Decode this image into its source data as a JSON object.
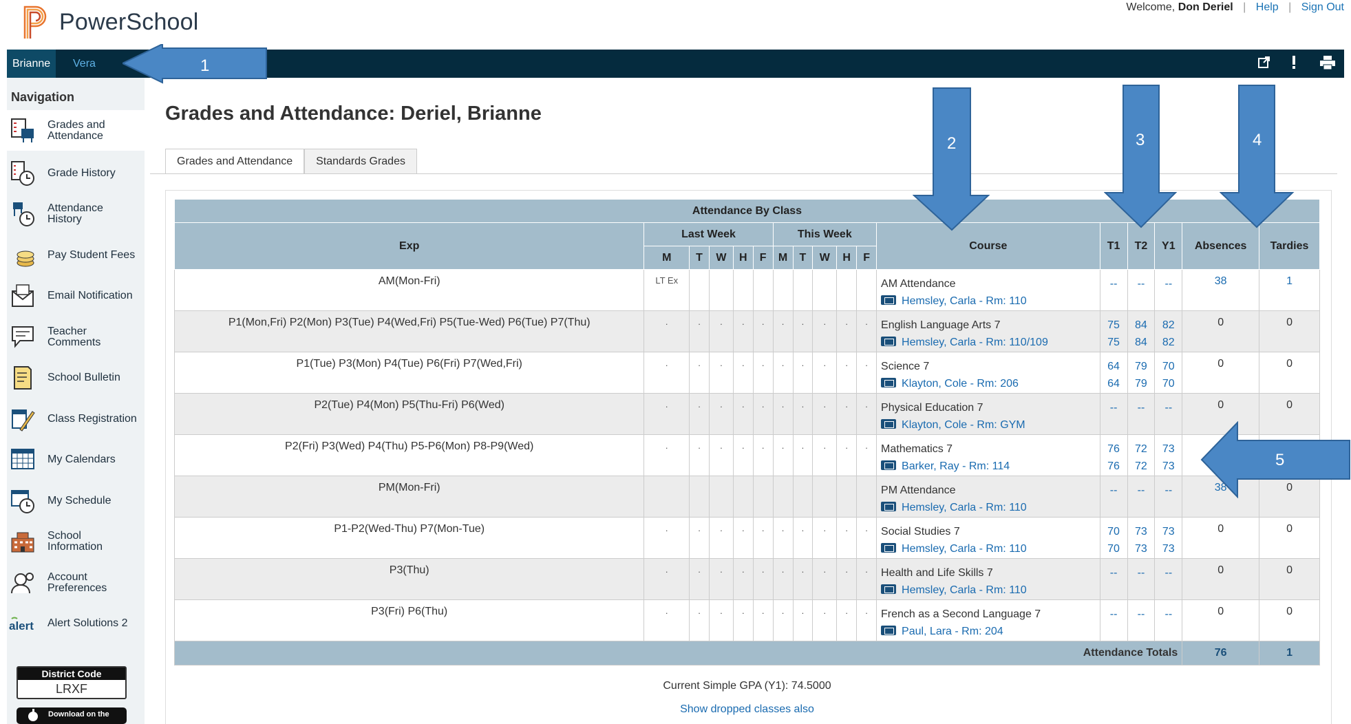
{
  "app": {
    "name": "PowerSchool"
  },
  "top_links": {
    "welcome_prefix": "Welcome,",
    "user_name": "Don Deriel",
    "help": "Help",
    "sign_out": "Sign Out"
  },
  "students": [
    "Brianne",
    "Vera"
  ],
  "toolbar_icons": [
    "external-link-icon",
    "alert-icon",
    "print-icon"
  ],
  "nav": {
    "title": "Navigation",
    "items": [
      {
        "label": "Grades and Attendance",
        "icon": "grades-attendance-icon"
      },
      {
        "label": "Grade History",
        "icon": "grade-history-icon"
      },
      {
        "label": "Attendance History",
        "icon": "attendance-history-icon"
      },
      {
        "label": "Pay Student Fees",
        "icon": "fees-icon"
      },
      {
        "label": "Email Notification",
        "icon": "email-icon"
      },
      {
        "label": "Teacher Comments",
        "icon": "comments-icon"
      },
      {
        "label": "School Bulletin",
        "icon": "bulletin-icon"
      },
      {
        "label": "Class Registration",
        "icon": "registration-icon"
      },
      {
        "label": "My Calendars",
        "icon": "calendar-icon"
      },
      {
        "label": "My Schedule",
        "icon": "schedule-icon"
      },
      {
        "label": "School Information",
        "icon": "school-icon"
      },
      {
        "label": "Account Preferences",
        "icon": "account-icon"
      },
      {
        "label": "Alert Solutions 2",
        "icon": "alert-solutions-icon"
      }
    ],
    "district_code_label": "District Code",
    "district_code": "LRXF",
    "app_store": "Download on the"
  },
  "page": {
    "title": "Grades and Attendance: Deriel, Brianne",
    "tabs": [
      "Grades and Attendance",
      "Standards Grades"
    ]
  },
  "table": {
    "caption": "Attendance By Class",
    "col_exp": "Exp",
    "last_week": "Last Week",
    "this_week": "This Week",
    "days": [
      "M",
      "T",
      "W",
      "H",
      "F",
      "M",
      "T",
      "W",
      "H",
      "F"
    ],
    "col_course": "Course",
    "col_t1": "T1",
    "col_t2": "T2",
    "col_y1": "Y1",
    "col_absences": "Absences",
    "col_tardies": "Tardies",
    "rows": [
      {
        "exp": "AM(Mon-Fri)",
        "days": [
          "LT Ex",
          "",
          "",
          "",
          "",
          "",
          "",
          "",
          "",
          ""
        ],
        "course": "AM Attendance",
        "teacher": "Hemsley, Carla",
        "room": "- Rm: 110",
        "t1": [
          "--"
        ],
        "t2": [
          "--"
        ],
        "y1": [
          "--"
        ],
        "absences": "38",
        "absences_link": true,
        "tardies": "1",
        "tardies_link": true
      },
      {
        "exp": "P1(Mon,Fri) P2(Mon) P3(Tue) P4(Wed,Fri) P5(Tue-Wed) P6(Tue) P7(Thu)",
        "days": [
          ".",
          ".",
          ".",
          ".",
          ".",
          ".",
          ".",
          ".",
          ".",
          "."
        ],
        "course": "English Language Arts 7",
        "teacher": "Hemsley, Carla",
        "room": "- Rm: 110/109",
        "t1": [
          "75",
          "75"
        ],
        "t2": [
          "84",
          "84"
        ],
        "y1": [
          "82",
          "82"
        ],
        "absences": "0",
        "tardies": "0"
      },
      {
        "exp": "P1(Tue) P3(Mon) P4(Tue) P6(Fri) P7(Wed,Fri)",
        "days": [
          ".",
          ".",
          ".",
          ".",
          ".",
          ".",
          ".",
          ".",
          ".",
          "."
        ],
        "course": "Science 7",
        "teacher": "Klayton, Cole",
        "room": "- Rm: 206",
        "t1": [
          "64",
          "64"
        ],
        "t2": [
          "79",
          "79"
        ],
        "y1": [
          "70",
          "70"
        ],
        "absences": "0",
        "tardies": "0"
      },
      {
        "exp": "P2(Tue) P4(Mon) P5(Thu-Fri) P6(Wed)",
        "days": [
          ".",
          ".",
          ".",
          ".",
          ".",
          ".",
          ".",
          ".",
          ".",
          "."
        ],
        "course": "Physical Education 7",
        "teacher": "Klayton, Cole",
        "room": "- Rm: GYM",
        "t1": [
          "--"
        ],
        "t2": [
          "--"
        ],
        "y1": [
          "--"
        ],
        "absences": "0",
        "tardies": "0"
      },
      {
        "exp": "P2(Fri) P3(Wed) P4(Thu) P5-P6(Mon) P8-P9(Wed)",
        "days": [
          ".",
          ".",
          ".",
          ".",
          ".",
          ".",
          ".",
          ".",
          ".",
          "."
        ],
        "course": "Mathematics 7",
        "teacher": "Barker, Ray",
        "room": "- Rm: 114",
        "t1": [
          "76",
          "76"
        ],
        "t2": [
          "72",
          "72"
        ],
        "y1": [
          "73",
          "73"
        ],
        "absences": "",
        "tardies": ""
      },
      {
        "exp": "PM(Mon-Fri)",
        "days": [
          "",
          "",
          "",
          "",
          "",
          "",
          "",
          "",
          "",
          ""
        ],
        "course": "PM Attendance",
        "teacher": "Hemsley, Carla",
        "room": "- Rm: 110",
        "t1": [
          "--"
        ],
        "t2": [
          "--"
        ],
        "y1": [
          "--"
        ],
        "absences": "38",
        "absences_link": true,
        "tardies": "0"
      },
      {
        "exp": "P1-P2(Wed-Thu) P7(Mon-Tue)",
        "days": [
          ".",
          ".",
          ".",
          ".",
          ".",
          ".",
          ".",
          ".",
          ".",
          "."
        ],
        "course": "Social Studies 7",
        "teacher": "Hemsley, Carla",
        "room": "- Rm: 110",
        "t1": [
          "70",
          "70"
        ],
        "t2": [
          "73",
          "73"
        ],
        "y1": [
          "73",
          "73"
        ],
        "absences": "0",
        "tardies": "0"
      },
      {
        "exp": "P3(Thu)",
        "days": [
          ".",
          ".",
          ".",
          ".",
          ".",
          ".",
          ".",
          ".",
          ".",
          "."
        ],
        "course": "Health and Life Skills 7",
        "teacher": "Hemsley, Carla",
        "room": "- Rm: 110",
        "t1": [
          "--"
        ],
        "t2": [
          "--"
        ],
        "y1": [
          "--"
        ],
        "absences": "0",
        "tardies": "0"
      },
      {
        "exp": "P3(Fri) P6(Thu)",
        "days": [
          ".",
          ".",
          ".",
          ".",
          ".",
          ".",
          ".",
          ".",
          ".",
          "."
        ],
        "course": "French as a Second Language 7",
        "teacher": "Paul, Lara",
        "room": "- Rm: 204",
        "t1": [
          "--"
        ],
        "t2": [
          "--"
        ],
        "y1": [
          "--"
        ],
        "absences": "0",
        "tardies": "0"
      }
    ],
    "totals_label": "Attendance Totals",
    "total_absences": "76",
    "total_tardies": "1"
  },
  "gpa_text": "Current Simple GPA (Y1): 74.5000",
  "dropped_link": "Show dropped classes also",
  "callouts": [
    "1",
    "2",
    "3",
    "4",
    "5"
  ],
  "colors": {
    "header_bar": "#052b3e",
    "table_header": "#a3bccb",
    "link": "#1a6bb0",
    "callout": "#4a87c5"
  }
}
